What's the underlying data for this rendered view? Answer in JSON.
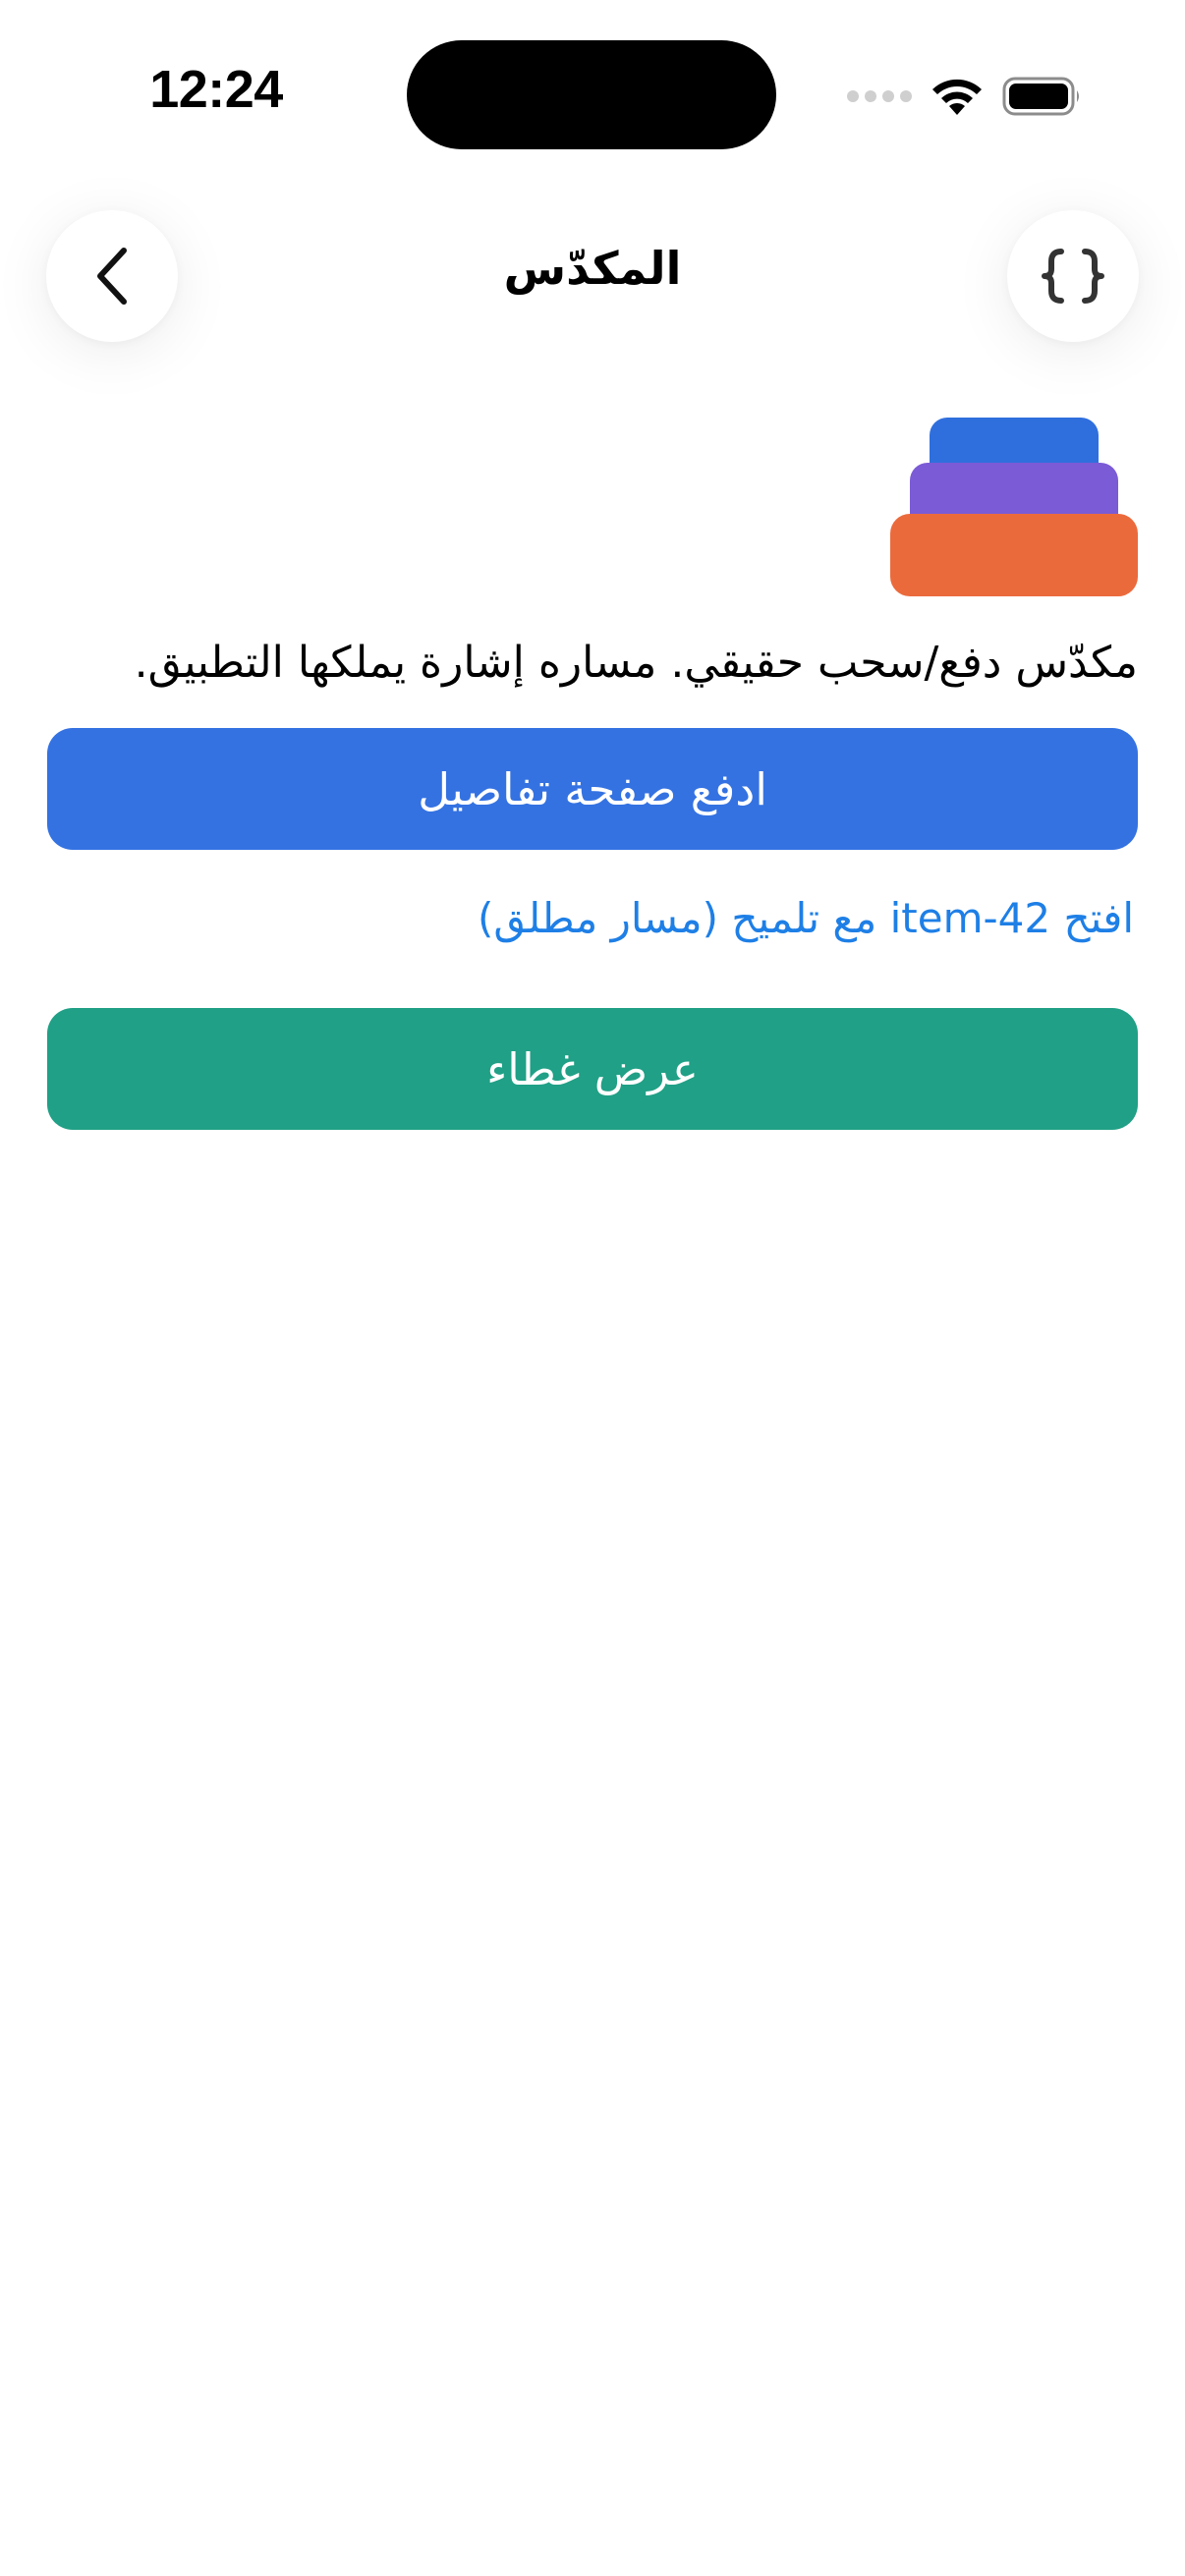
{
  "status_bar": {
    "time": "12:24"
  },
  "nav": {
    "title": "المكدّس",
    "back_icon": "chevron-left-icon",
    "right_icon": "code-braces-icon"
  },
  "content": {
    "logo_icon": "stack-icon",
    "description": "مكدّس دفع/سحب حقيقي. مساره إشارة يملكها التطبيق.",
    "push_button_label": "ادفع صفحة تفاصيل",
    "link_label": "افتح item-42 مع تلميح (مسار مطلق)",
    "overlay_button_label": "عرض غطاء"
  },
  "colors": {
    "push_button": "#3472E2",
    "overlay_button": "#20A086",
    "link": "#1E7FE6",
    "stack_top": "#2F6FDD",
    "stack_middle": "#7B5BD6",
    "stack_bottom": "#EB6A3C"
  }
}
